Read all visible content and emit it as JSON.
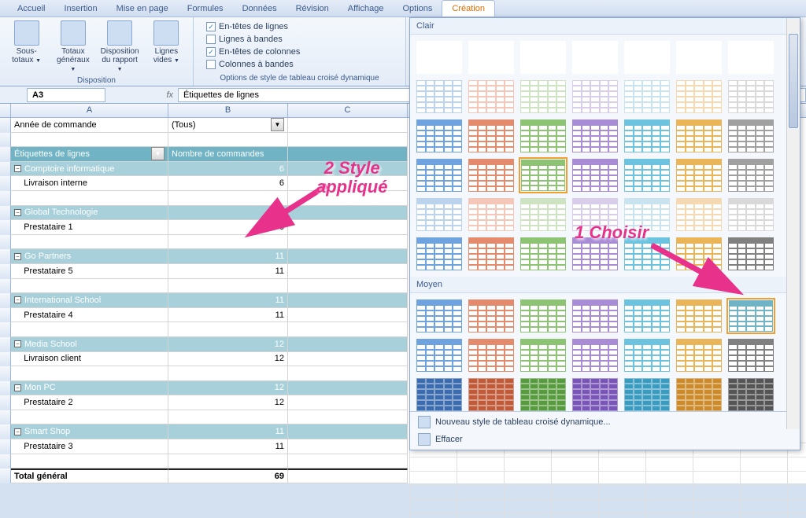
{
  "ribbon": {
    "tabs": [
      "Accueil",
      "Insertion",
      "Mise en page",
      "Formules",
      "Données",
      "Révision",
      "Affichage",
      "Options",
      "Création"
    ],
    "active_tab": "Création",
    "group_layout": {
      "title": "Disposition",
      "buttons": [
        {
          "label": "Sous-totaux"
        },
        {
          "label": "Totaux généraux"
        },
        {
          "label": "Disposition du rapport"
        },
        {
          "label": "Lignes vides"
        }
      ]
    },
    "group_style_options": {
      "title": "Options de style de tableau croisé dynamique",
      "opts": [
        {
          "label": "En-têtes de lignes",
          "checked": true
        },
        {
          "label": "Lignes à bandes",
          "checked": false
        },
        {
          "label": "En-têtes de colonnes",
          "checked": true
        },
        {
          "label": "Colonnes à bandes",
          "checked": false
        }
      ]
    }
  },
  "formula_bar": {
    "name_box": "A3",
    "fx": "fx",
    "value": "Étiquettes de lignes"
  },
  "columns": [
    "A",
    "B",
    "C"
  ],
  "pivot": {
    "filter_field": "Année de commande",
    "filter_value": "(Tous)",
    "row_header": "Étiquettes de lignes",
    "val_header": "Nombre de commandes",
    "groups": [
      {
        "name": "Comptoire informatique",
        "val": 6,
        "items": [
          {
            "name": "Livraison interne",
            "val": 6
          }
        ]
      },
      {
        "name": "Global Technologie",
        "val": 6,
        "items": [
          {
            "name": "Prestataire 1",
            "val": 6
          }
        ]
      },
      {
        "name": "Go Partners",
        "val": 11,
        "items": [
          {
            "name": "Prestataire 5",
            "val": 11
          }
        ]
      },
      {
        "name": "International School",
        "val": 11,
        "items": [
          {
            "name": "Prestataire 4",
            "val": 11
          }
        ]
      },
      {
        "name": "Media School",
        "val": 12,
        "items": [
          {
            "name": "Livraison client",
            "val": 12
          }
        ]
      },
      {
        "name": "Mon PC",
        "val": 12,
        "items": [
          {
            "name": "Prestataire 2",
            "val": 12
          }
        ]
      },
      {
        "name": "Smart Shop",
        "val": 11,
        "items": [
          {
            "name": "Prestataire 3",
            "val": 11
          }
        ]
      }
    ],
    "total_label": "Total général",
    "total_val": 69
  },
  "gallery": {
    "section_clair": "Clair",
    "section_moyen": "Moyen",
    "footer": [
      {
        "label": "Nouveau style de tableau croisé dynamique..."
      },
      {
        "label": "Effacer"
      }
    ],
    "clair_colors": [
      [
        "#fff",
        "#fff",
        "#fff",
        "#fff",
        "#fff",
        "#fff",
        "#fff"
      ],
      [
        "#bcd3ed",
        "#f5c7b9",
        "#cde3c1",
        "#d9ceea",
        "#c9e3ef",
        "#f5d9b2",
        "#d9d9d9"
      ],
      [
        "#6fa3df",
        "#e38b6c",
        "#8cc474",
        "#a88cd5",
        "#6cc3e0",
        "#eab559",
        "#a0a0a0"
      ],
      [
        "#6fa3df",
        "#e38b6c",
        "#8cc474",
        "#a88cd5",
        "#6cc3e0",
        "#eab559",
        "#a0a0a0"
      ],
      [
        "#bcd3ed",
        "#f5c7b9",
        "#cde3c1",
        "#d9ceea",
        "#c9e3ef",
        "#f5d9b2",
        "#d9d9d9"
      ],
      [
        "#6fa3df",
        "#e38b6c",
        "#8cc474",
        "#a88cd5",
        "#6cc3e0",
        "#eab559",
        "#808080"
      ]
    ],
    "moyen_colors": [
      [
        "#6fa3df",
        "#e38b6c",
        "#8cc474",
        "#a88cd5",
        "#6cc3e0",
        "#eab559",
        "#6fb3c5"
      ],
      [
        "#6fa3df",
        "#e38b6c",
        "#8cc474",
        "#a88cd5",
        "#6cc3e0",
        "#eab559",
        "#808080"
      ],
      [
        "#3b6cb0",
        "#c05a38",
        "#589a3e",
        "#7a55b8",
        "#3a9bc0",
        "#cc8a2a",
        "#555"
      ]
    ],
    "clair_selected": {
      "row": 3,
      "col": 2
    },
    "moyen_selected": {
      "row": 0,
      "col": 6
    }
  },
  "annotations": {
    "a2": "2 Style\nappliqué",
    "a1": "1 Choisir"
  }
}
